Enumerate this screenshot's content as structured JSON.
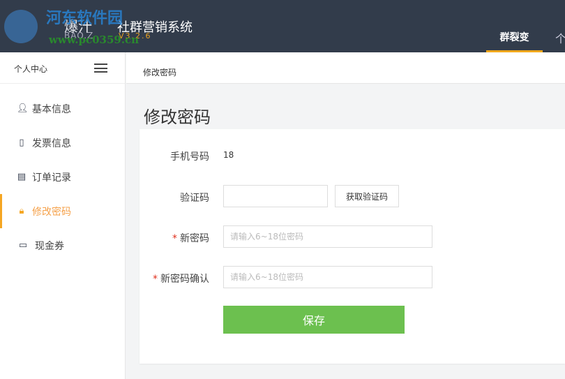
{
  "header": {
    "logo_main": "爆汁",
    "logo_sub": "BAO.Z",
    "system_name": "社群营销系统",
    "version": "V3.2.6",
    "watermark": "河东软件园",
    "watermark_url": "www.pc0359.cn",
    "nav_tab": "群裂变",
    "nav_more": "个"
  },
  "sidebar": {
    "title": "个人中心",
    "items": [
      {
        "label": "基本信息",
        "icon": "user-icon"
      },
      {
        "label": "发票信息",
        "icon": "clipboard-icon"
      },
      {
        "label": "订单记录",
        "icon": "list-icon"
      },
      {
        "label": "修改密码",
        "icon": "lock-icon",
        "active": true
      },
      {
        "label": "现金券",
        "icon": "cash-icon"
      }
    ]
  },
  "breadcrumb": "修改密码",
  "page_title": "修改密码",
  "form": {
    "phone_label": "手机号码",
    "phone_value": "18",
    "code_label": "验证码",
    "code_value": "",
    "get_code_button": "获取验证码",
    "new_password_label": "新密码",
    "new_password_placeholder": "请输入6~18位密码",
    "confirm_label": "新密码确认",
    "confirm_placeholder": "请输入6~18位密码",
    "required_mark": "*",
    "save_button": "保存"
  },
  "colors": {
    "header": "#323c4b",
    "accent": "#f5a623",
    "save": "#6cc04f"
  }
}
